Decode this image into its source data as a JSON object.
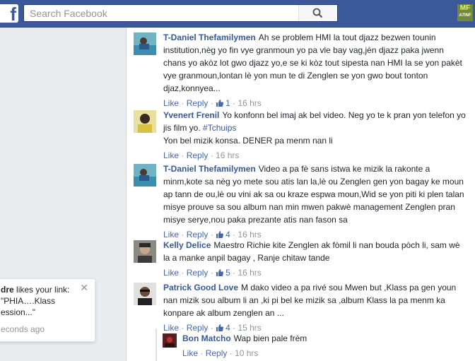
{
  "search": {
    "placeholder": "Search Facebook"
  },
  "badge": {
    "line1": "MF",
    "line2": "A7INF"
  },
  "notification": {
    "actor": "dre",
    "text_after": " likes your link: ",
    "link_text": "\"PHIA….Klass ession...\"",
    "time": "econds ago"
  },
  "comments": [
    {
      "author": "T-Daniel Thefamilymen",
      "text": "Ah se problem HMI la tout djazz bezwen tounin institution,nèg yo fin vye granmoun yo pa vle bay vag,jèn djazz paka jwenn chans yo akòz lot gwo djazz yo,e se ki kòz tout sipesta nan HMI la se yon pakèt vye granmoun,lontan lè yon mun te di Zenglen se yon gwo bout tonton djaz,konnyea...",
      "like": "Like",
      "reply": "Reply",
      "likes": "1",
      "time": "16 hrs"
    },
    {
      "author": "Yvenert Frenil",
      "text": "Yo konfonn bel imaj ak bel video. Neg yo te k pran yon telefon yo jis film yo.",
      "hashtag": "#Tchuips",
      "text2": "Yon bel mizik konsa. DENER pa menm nan li",
      "like": "Like",
      "reply": "Reply",
      "time": "16 hrs"
    },
    {
      "author": "T-Daniel Thefamilymen",
      "text": "Video a pa fè sans istwa ke mizik la rakonte a minm,kote sa nèg yo mete sou atis lan la,lè ou Zenglen gen yon bagay ke moun ap tann de ou,lè ou vini ak sa ou kraze espwa moun,Wid se yon piti ki plen talan misye prouve sa sou album nan min mwen pakwè management Zenglen pran misye serye,nou paka prezante atis nan fason sa",
      "like": "Like",
      "reply": "Reply",
      "likes": "4",
      "time": "16 hrs"
    },
    {
      "author": "Kelly Delice",
      "text": "Maestro Richie kite Zenglen ak fòmil li nan bouda pòch li, sam wè la a manke anpil bagay , Ranje chitaw tande",
      "like": "Like",
      "reply": "Reply",
      "likes": "5",
      "time": "16 hrs"
    },
    {
      "author": "Patrick Good Love",
      "text": "M dako video a pa rivé sou Mwen but ,Klass pa gen youn nan mizik sou album li an ,ki pi bel ke mizik sa ,album Klass la pa menm ka konpare ak album zenglen an ...",
      "like": "Like",
      "reply": "Reply",
      "likes": "4",
      "time": "15 hrs"
    }
  ],
  "reply": {
    "author": "Bon Matcho",
    "text": "Wap bien pale frèm",
    "like": "Like",
    "reply": "Reply",
    "time": "10 hrs"
  },
  "separator": "·"
}
